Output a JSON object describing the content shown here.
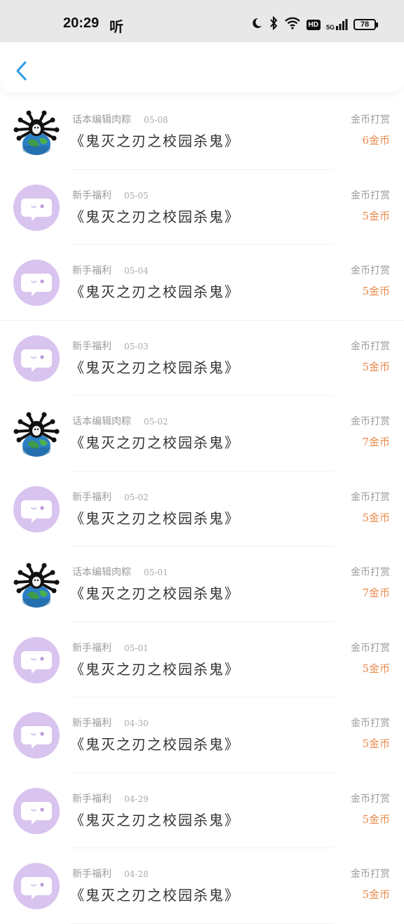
{
  "status_bar": {
    "time": "20:29",
    "listen": "听",
    "battery": "78",
    "net_hd": "HD",
    "net_5g": "5G"
  },
  "nav": {
    "back_icon": "chevron-left-icon",
    "accent": "#2f9be6"
  },
  "colors": {
    "amount": "#e8894a",
    "avatar_purple": "#d9c3ef",
    "meta": "#9b9b9b"
  },
  "records": [
    {
      "avatar": "creature-globe",
      "source": "话本编辑肉粽",
      "date": "05-08",
      "title": "《鬼灭之刃之校园杀鬼》",
      "type": "金币打赏",
      "amount": "6金币"
    },
    {
      "avatar": "chat-bubble",
      "source": "新手福利",
      "date": "05-05",
      "title": "《鬼灭之刃之校园杀鬼》",
      "type": "金币打赏",
      "amount": "5金币"
    },
    {
      "avatar": "chat-bubble",
      "source": "新手福利",
      "date": "05-04",
      "title": "《鬼灭之刃之校园杀鬼》",
      "type": "金币打赏",
      "amount": "5金币"
    },
    {
      "avatar": "chat-bubble",
      "source": "新手福利",
      "date": "05-03",
      "title": "《鬼灭之刃之校园杀鬼》",
      "type": "金币打赏",
      "amount": "5金币"
    },
    {
      "avatar": "creature-globe",
      "source": "话本编辑肉粽",
      "date": "05-02",
      "title": "《鬼灭之刃之校园杀鬼》",
      "type": "金币打赏",
      "amount": "7金币"
    },
    {
      "avatar": "chat-bubble",
      "source": "新手福利",
      "date": "05-02",
      "title": "《鬼灭之刃之校园杀鬼》",
      "type": "金币打赏",
      "amount": "5金币"
    },
    {
      "avatar": "creature-globe",
      "source": "话本编辑肉粽",
      "date": "05-01",
      "title": "《鬼灭之刃之校园杀鬼》",
      "type": "金币打赏",
      "amount": "7金币"
    },
    {
      "avatar": "chat-bubble",
      "source": "新手福利",
      "date": "05-01",
      "title": "《鬼灭之刃之校园杀鬼》",
      "type": "金币打赏",
      "amount": "5金币"
    },
    {
      "avatar": "chat-bubble",
      "source": "新手福利",
      "date": "04-30",
      "title": "《鬼灭之刃之校园杀鬼》",
      "type": "金币打赏",
      "amount": "5金币"
    },
    {
      "avatar": "chat-bubble",
      "source": "新手福利",
      "date": "04-29",
      "title": "《鬼灭之刃之校园杀鬼》",
      "type": "金币打赏",
      "amount": "5金币"
    },
    {
      "avatar": "chat-bubble",
      "source": "新手福利",
      "date": "04-28",
      "title": "《鬼灭之刃之校园杀鬼》",
      "type": "金币打赏",
      "amount": "5金币"
    }
  ]
}
